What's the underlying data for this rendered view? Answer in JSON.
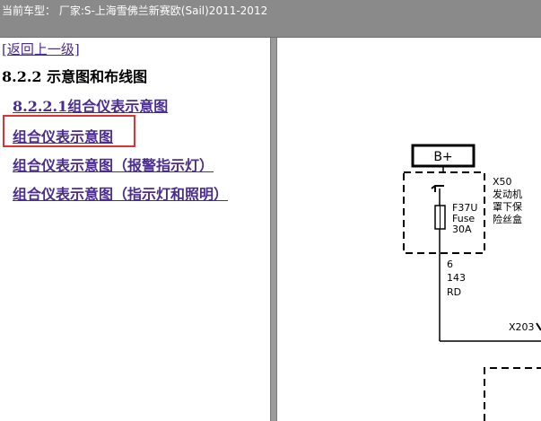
{
  "header": {
    "title": "当前车型：  厂家:S-上海雪佛兰新赛欧(Sail)2011-2012"
  },
  "nav": {
    "back_label": "[返回上一级]",
    "section_heading": "8.2.2 示意图和布线图",
    "links": [
      "8.2.2.1组合仪表示意图",
      "组合仪表示意图",
      "组合仪表示意图（报警指示灯）",
      "组合仪表示意图（指示灯和照明）"
    ],
    "selected_index": 1,
    "highlight_color": "#e03232",
    "link_color": "#4b2c8f"
  },
  "diagram": {
    "power_label": "B+",
    "fuse_id": "F37U",
    "fuse_type": "Fuse",
    "fuse_rating": "30A",
    "box_label_1": "X50",
    "box_label_2": "发动机",
    "box_label_3": "罩下保",
    "box_label_4": "险丝盒",
    "pin": "6",
    "circuit": "143",
    "wire_color": "RD",
    "connector": "X203"
  }
}
